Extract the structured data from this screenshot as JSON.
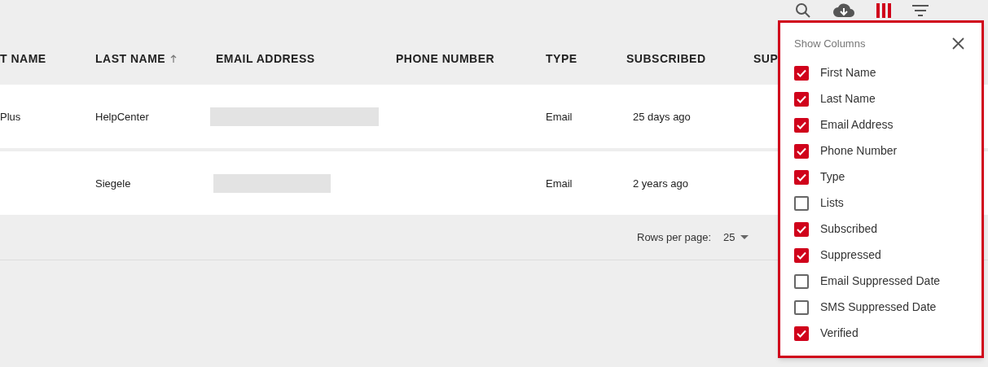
{
  "toolbar": [
    {
      "kind": "search",
      "selected": false
    },
    {
      "kind": "download",
      "selected": false
    },
    {
      "kind": "columns",
      "selected": true
    },
    {
      "kind": "filter",
      "selected": false
    }
  ],
  "table": {
    "columns": [
      {
        "label": "T NAME",
        "sorted": false
      },
      {
        "label": "LAST NAME",
        "sorted": true
      },
      {
        "label": "EMAIL ADDRESS",
        "sorted": false
      },
      {
        "label": "PHONE NUMBER",
        "sorted": false
      },
      {
        "label": "TYPE",
        "sorted": false
      },
      {
        "label": "SUBSCRIBED",
        "sorted": false
      },
      {
        "label": "SUP",
        "sorted": false
      }
    ],
    "rows": [
      {
        "first": "Plus",
        "last": "HelpCenter",
        "email_redacted": true,
        "type": "Email",
        "subscribed": "25 days ago"
      },
      {
        "last": "Siegele",
        "email_redacted": true,
        "type": "Email",
        "subscribed": "2 years ago"
      }
    ]
  },
  "pagination": {
    "label": "Rows per page:",
    "value": "25"
  },
  "show_columns": {
    "title": "Show Columns",
    "items": [
      {
        "label": "First Name",
        "checked": true
      },
      {
        "label": "Last Name",
        "checked": true
      },
      {
        "label": "Email Address",
        "checked": true
      },
      {
        "label": "Phone Number",
        "checked": true
      },
      {
        "label": "Type",
        "checked": true
      },
      {
        "label": "Lists",
        "checked": false
      },
      {
        "label": "Subscribed",
        "checked": true
      },
      {
        "label": "Suppressed",
        "checked": true
      },
      {
        "label": "Email Suppressed Date",
        "checked": false
      },
      {
        "label": "SMS Suppressed Date",
        "checked": false
      },
      {
        "label": "Verified",
        "checked": true
      }
    ]
  }
}
